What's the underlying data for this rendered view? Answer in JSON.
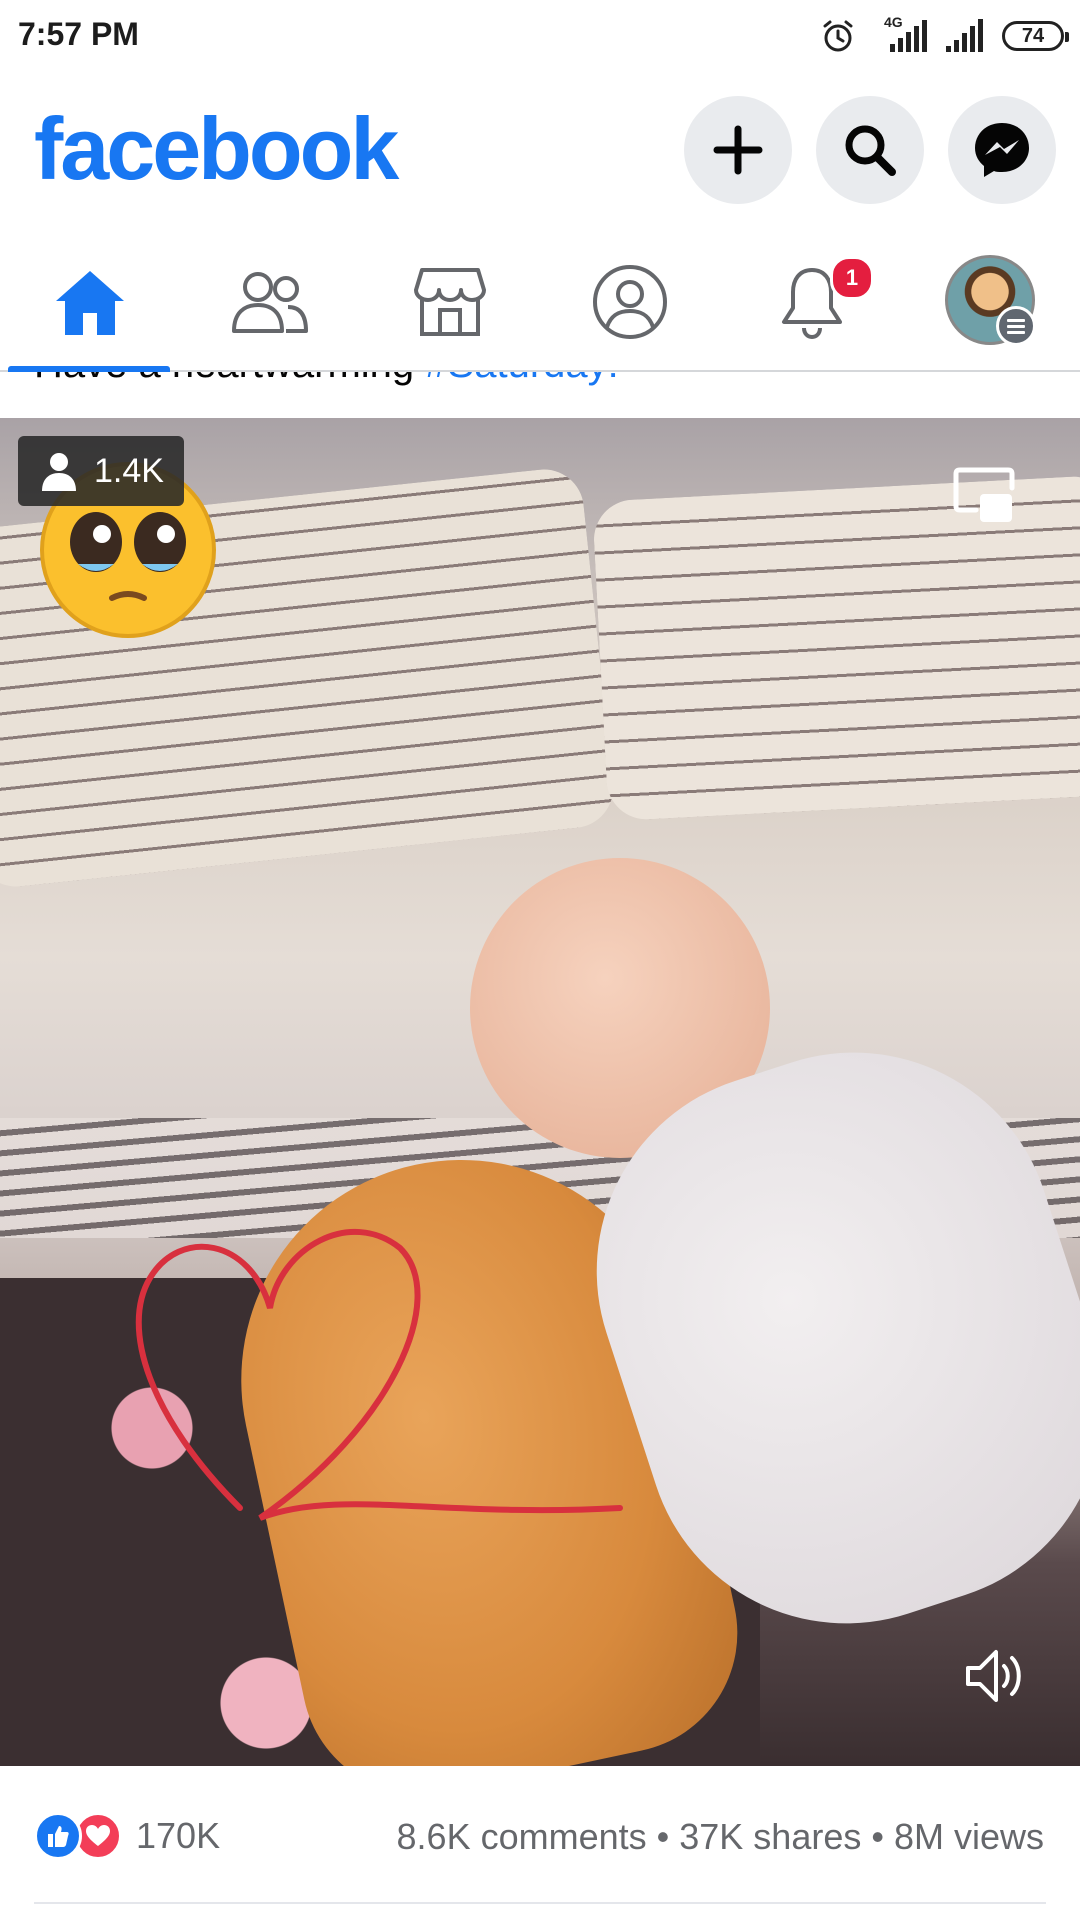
{
  "status_bar": {
    "time": "7:57 PM",
    "network_label": "4G",
    "battery": "74",
    "icons": [
      "alarm-icon",
      "signal-icon",
      "signal-icon",
      "battery-icon"
    ]
  },
  "header": {
    "logo": "facebook",
    "buttons": [
      "plus-icon",
      "search-icon",
      "messenger-icon"
    ]
  },
  "tabs": [
    {
      "name": "home",
      "icon": "home-icon",
      "active": true
    },
    {
      "name": "friends",
      "icon": "friends-icon",
      "active": false
    },
    {
      "name": "marketplace",
      "icon": "marketplace-icon",
      "active": false
    },
    {
      "name": "profile",
      "icon": "profile-icon",
      "active": false
    },
    {
      "name": "notifications",
      "icon": "bell-icon",
      "active": false,
      "badge": "1"
    },
    {
      "name": "menu",
      "icon": "avatar",
      "active": false
    }
  ],
  "post": {
    "caption_text": "Have a heartwarming ",
    "caption_tag": "#Saturday!",
    "video": {
      "viewer_count": "1.4K"
    },
    "reactions_count": "170K",
    "stats": "8.6K comments • 37K shares • 8M views"
  },
  "colors": {
    "brand": "#1877f2",
    "badge": "#e41e3f",
    "love": "#f33e58",
    "muted_text": "#65676b"
  }
}
